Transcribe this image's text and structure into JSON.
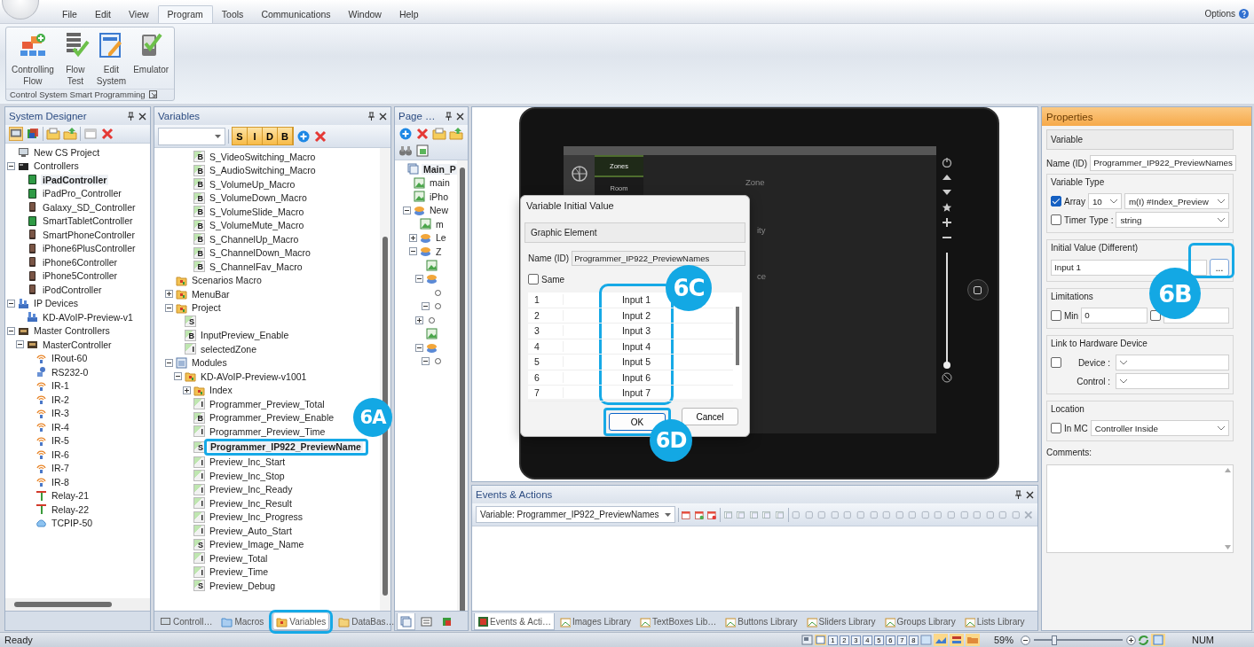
{
  "menu": {
    "items": [
      {
        "label": "File",
        "selected": false
      },
      {
        "label": "Edit",
        "selected": false
      },
      {
        "label": "View",
        "selected": false
      },
      {
        "label": "Program",
        "selected": true
      },
      {
        "label": "Tools",
        "selected": false
      },
      {
        "label": "Communications",
        "selected": false
      },
      {
        "label": "Window",
        "selected": false
      },
      {
        "label": "Help",
        "selected": false
      }
    ],
    "options": "Options"
  },
  "ribbon": {
    "buttons": [
      {
        "label": "Controlling Flow",
        "kind": "flow"
      },
      {
        "label": "Flow Test",
        "kind": "test"
      },
      {
        "label": "Edit System",
        "kind": "edit"
      },
      {
        "label": "Emulator",
        "kind": "emulator"
      }
    ],
    "group_label": "Control System Smart Programming"
  },
  "system_designer": {
    "title": "System Designer",
    "tree": [
      {
        "label": "New CS Project",
        "kind": "project",
        "selected": false
      },
      {
        "label": "Controllers",
        "kind": "rack",
        "expanded": true,
        "selected": false,
        "children": [
          {
            "label": "iPadController",
            "kind": "tablet",
            "selected": true
          },
          {
            "label": "iPadPro_Controller",
            "kind": "tablet",
            "selected": false
          },
          {
            "label": "Galaxy_SD_Controller",
            "kind": "phone",
            "selected": false
          },
          {
            "label": "SmartTabletController",
            "kind": "tablet",
            "selected": false
          },
          {
            "label": "SmartPhoneController",
            "kind": "phone",
            "selected": false
          },
          {
            "label": "iPhone6PlusController",
            "kind": "phone",
            "selected": false
          },
          {
            "label": "iPhone6Controller",
            "kind": "phone",
            "selected": false
          },
          {
            "label": "iPhone5Controller",
            "kind": "phone",
            "selected": false
          },
          {
            "label": "iPodController",
            "kind": "phone",
            "selected": false
          }
        ]
      },
      {
        "label": "IP Devices",
        "kind": "network",
        "expanded": true,
        "selected": false,
        "children": [
          {
            "label": "KD-AVoIP-Preview-v1",
            "kind": "network",
            "selected": false
          }
        ]
      },
      {
        "label": "Master Controllers",
        "kind": "master",
        "expanded": true,
        "selected": false,
        "children": [
          {
            "label": "MasterController",
            "kind": "master",
            "expanded": true,
            "selected": false,
            "children": [
              {
                "label": "IRout-60",
                "kind": "ir",
                "selected": false
              },
              {
                "label": "RS232-0",
                "kind": "serial",
                "selected": false
              },
              {
                "label": "IR-1",
                "kind": "ir",
                "selected": false
              },
              {
                "label": "IR-2",
                "kind": "ir",
                "selected": false
              },
              {
                "label": "IR-3",
                "kind": "ir",
                "selected": false
              },
              {
                "label": "IR-4",
                "kind": "ir",
                "selected": false
              },
              {
                "label": "IR-5",
                "kind": "ir",
                "selected": false
              },
              {
                "label": "IR-6",
                "kind": "ir",
                "selected": false
              },
              {
                "label": "IR-7",
                "kind": "ir",
                "selected": false
              },
              {
                "label": "IR-8",
                "kind": "ir",
                "selected": false
              },
              {
                "label": "Relay-21",
                "kind": "relay",
                "selected": false
              },
              {
                "label": "Relay-22",
                "kind": "relay",
                "selected": false
              },
              {
                "label": "TCPIP-50",
                "kind": "cloud",
                "selected": false
              }
            ]
          }
        ]
      }
    ]
  },
  "variables": {
    "title": "Variables",
    "filter_buttons": [
      "S",
      "I",
      "D",
      "B"
    ],
    "continued_items": [
      {
        "label": "S_VideoSwitching_Macro",
        "type": "B",
        "selected": false
      },
      {
        "label": "S_AudioSwitching_Macro",
        "type": "B",
        "selected": false
      },
      {
        "label": "S_VolumeUp_Macro",
        "type": "B",
        "selected": false
      },
      {
        "label": "S_VolumeDown_Macro",
        "type": "B",
        "selected": false
      },
      {
        "label": "S_VolumeSlide_Macro",
        "type": "B",
        "selected": false
      },
      {
        "label": "S_VolumeMute_Macro",
        "type": "B",
        "selected": false
      },
      {
        "label": "S_ChannelUp_Macro",
        "type": "B",
        "selected": false
      },
      {
        "label": "S_ChannelDown_Macro",
        "type": "B",
        "selected": false
      },
      {
        "label": "S_ChannelFav_Macro",
        "type": "B",
        "selected": false
      }
    ],
    "tree": [
      {
        "label": "Scenarios Macro",
        "kind": "folder",
        "selected": false
      },
      {
        "label": "MenuBar",
        "kind": "folder",
        "expanded": false,
        "selected": false
      },
      {
        "label": "Project",
        "kind": "folder",
        "expanded": true,
        "selected": false,
        "children": [
          {
            "type": "S",
            "selected": false
          },
          {
            "label": "InputPreview_Enable",
            "type": "B",
            "selected": false
          },
          {
            "label": "selectedZone",
            "type": "I",
            "selected": false
          }
        ]
      },
      {
        "label": "Modules",
        "kind": "module",
        "expanded": true,
        "selected": false,
        "children": [
          {
            "label": "KD-AVoIP-Preview-v1001",
            "kind": "folder",
            "expanded": true,
            "selected": false,
            "children": [
              {
                "label": "Index",
                "kind": "folder",
                "expanded": false,
                "selected": false
              },
              {
                "label": "Programmer_Preview_Total",
                "type": "I",
                "selected": false
              },
              {
                "label": "Programmer_Preview_Enable",
                "type": "B",
                "selected": false
              },
              {
                "label": "Programmer_Preview_Time",
                "type": "I",
                "selected": false
              },
              {
                "label": "Programmer_IP922_PreviewName",
                "type": "S",
                "selected": true,
                "callout": "6A"
              },
              {
                "label": "Preview_Inc_Start",
                "type": "I",
                "selected": false
              },
              {
                "label": "Preview_Inc_Stop",
                "type": "I",
                "selected": false
              },
              {
                "label": "Preview_Inc_Ready",
                "type": "I",
                "selected": false
              },
              {
                "label": "Preview_Inc_Result",
                "type": "I",
                "selected": false
              },
              {
                "label": "Preview_Inc_Progress",
                "type": "I",
                "selected": false
              },
              {
                "label": "Preview_Auto_Start",
                "type": "I",
                "selected": false
              },
              {
                "label": "Preview_Image_Name",
                "type": "S",
                "selected": false
              },
              {
                "label": "Preview_Total",
                "type": "I",
                "selected": false
              },
              {
                "label": "Preview_Time",
                "type": "I",
                "selected": false
              },
              {
                "label": "Preview_Debug",
                "type": "S",
                "selected": false
              }
            ]
          }
        ]
      }
    ],
    "tabs": [
      {
        "label": "Controll…",
        "kind": "controllers",
        "selected": false,
        "highlighted": false
      },
      {
        "label": "Macros",
        "kind": "macros",
        "selected": false,
        "highlighted": false
      },
      {
        "label": "Variables",
        "kind": "variables",
        "selected": true,
        "highlighted": true
      },
      {
        "label": "DataBas…",
        "kind": "database",
        "selected": false,
        "highlighted": false
      }
    ]
  },
  "page_panel": {
    "title": "Page …",
    "tree": [
      {
        "label": "Main_P",
        "kind": "page",
        "selected": true,
        "children": [
          {
            "label": "main",
            "kind": "image",
            "selected": false
          },
          {
            "label": "iPho",
            "kind": "image",
            "selected": false
          },
          {
            "label": "New",
            "kind": "group",
            "expanded": true,
            "selected": false,
            "children": [
              {
                "label": "m",
                "kind": "image",
                "selected": false
              },
              {
                "label": "Le",
                "kind": "group",
                "expanded": false,
                "selected": false
              },
              {
                "label": "Z",
                "kind": "group",
                "expanded": true,
                "selected": false,
                "children": [
                  {
                    "kind": "image",
                    "selected": false
                  },
                  {
                    "kind": "group",
                    "expanded": true,
                    "selected": false,
                    "children": [
                      {
                        "kind": "node",
                        "selected": false
                      },
                      {
                        "kind": "node",
                        "expanded": true,
                        "selected": false
                      }
                    ]
                  },
                  {
                    "kind": "node",
                    "expanded": false,
                    "selected": false
                  },
                  {
                    "kind": "image",
                    "selected": false
                  },
                  {
                    "kind": "group",
                    "expanded": true,
                    "selected": false,
                    "children": [
                      {
                        "kind": "node",
                        "expanded": true,
                        "selected": false
                      }
                    ]
                  }
                ]
              }
            ]
          }
        ]
      }
    ],
    "tabs": [
      {
        "kind": "page",
        "selected": true
      },
      {
        "kind": "list",
        "selected": false
      },
      {
        "kind": "cube",
        "selected": false
      }
    ]
  },
  "canvas": {
    "menu": [
      {
        "label": "Zones",
        "selected": true
      },
      {
        "label": "Room",
        "selected": false
      }
    ],
    "heading": "Zone",
    "rows": [
      "ity",
      "ce"
    ],
    "volume": {
      "level": 0.02
    }
  },
  "dialog": {
    "title": "Variable Initial Value",
    "section": "Graphic Element",
    "name_label": "Name (ID)",
    "name_value": "Programmer_IP922_PreviewNames",
    "same": {
      "label": "Same",
      "checked": false
    },
    "rows": [
      {
        "index": "1",
        "value": "Input 1"
      },
      {
        "index": "2",
        "value": "Input 2"
      },
      {
        "index": "3",
        "value": "Input 3"
      },
      {
        "index": "4",
        "value": "Input 4"
      },
      {
        "index": "5",
        "value": "Input 5"
      },
      {
        "index": "6",
        "value": "Input 6"
      },
      {
        "index": "7",
        "value": "Input 7"
      }
    ],
    "values_callout": "6C",
    "buttons": [
      {
        "label": "OK",
        "kind": "primary",
        "callout": "6D"
      },
      {
        "label": "Cancel",
        "kind": "normal"
      }
    ]
  },
  "events": {
    "title": "Events & Actions",
    "selector": "Variable: Programmer_IP922_PreviewNames",
    "tabs": [
      {
        "label": "Events & Acti…",
        "selected": true
      },
      {
        "label": "Images Library",
        "selected": false
      },
      {
        "label": "TextBoxes Lib…",
        "selected": false
      },
      {
        "label": "Buttons Library",
        "selected": false
      },
      {
        "label": "Sliders Library",
        "selected": false
      },
      {
        "label": "Groups Library",
        "selected": false
      },
      {
        "label": "Lists Library",
        "selected": false
      }
    ]
  },
  "properties": {
    "title": "Properties",
    "section": "Variable",
    "name_label": "Name (ID)",
    "name_value": "Programmer_IP922_PreviewNames",
    "variable_type": {
      "title": "Variable Type",
      "array": {
        "label": "Array",
        "checked": true
      },
      "array_size": "10",
      "index": "m(I) #Index_Preview",
      "timer": {
        "label": "Timer",
        "checked": false
      },
      "type_label": "Type :",
      "type_value": "string"
    },
    "initial_value": {
      "title": "Initial Value (Different)",
      "value": "Input 1",
      "button": "...",
      "callout": "6B"
    },
    "limitations": {
      "title": "Limitations",
      "min": {
        "label": "Min",
        "checked": false,
        "value": "0"
      },
      "max": {
        "checked": false
      }
    },
    "hardware": {
      "title": "Link to Hardware Device",
      "linked": false,
      "device_label": "Device :",
      "control_label": "Control :"
    },
    "location": {
      "title": "Location",
      "in_mc": {
        "label": "In MC",
        "checked": false
      },
      "value": "Controller Inside"
    },
    "comments_label": "Comments:"
  },
  "status_bar": {
    "text": "Ready",
    "pages": [
      "1",
      "2",
      "3",
      "4",
      "5",
      "6",
      "7",
      "8"
    ],
    "zoom": "59%",
    "zoom_slider": {
      "level": 0.23
    },
    "num": "NUM"
  }
}
